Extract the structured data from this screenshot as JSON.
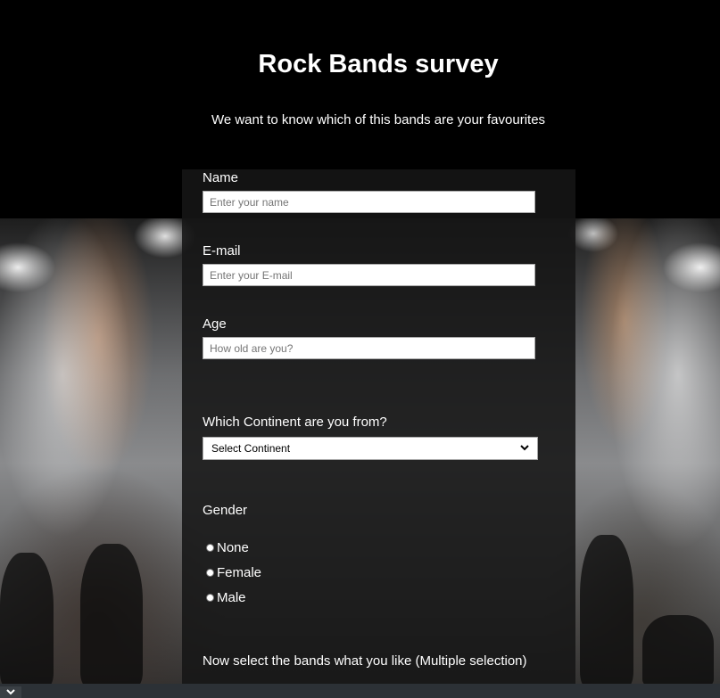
{
  "survey": {
    "title": "Rock Bands survey",
    "subtitle": "We want to know which of this bands are your favourites"
  },
  "fields": {
    "name": {
      "label": "Name",
      "placeholder": "Enter your name"
    },
    "email": {
      "label": "E-mail",
      "placeholder": "Enter your E-mail"
    },
    "age": {
      "label": "Age",
      "placeholder": "How old are you?"
    },
    "continent": {
      "label": "Which Continent are you from?",
      "selected": "Select Continent"
    }
  },
  "gender": {
    "label": "Gender",
    "options": [
      "None",
      "Female",
      "Male"
    ]
  },
  "bands": {
    "label": "Now select the bands what you like (Multiple selection)"
  },
  "icons": {
    "select_chevron": "chevron-down-icon",
    "bottom_toggle": "chevron-down-icon"
  },
  "colors": {
    "panel": "#161616",
    "text": "#ffffff",
    "bottom_bar": "#2c3136"
  }
}
